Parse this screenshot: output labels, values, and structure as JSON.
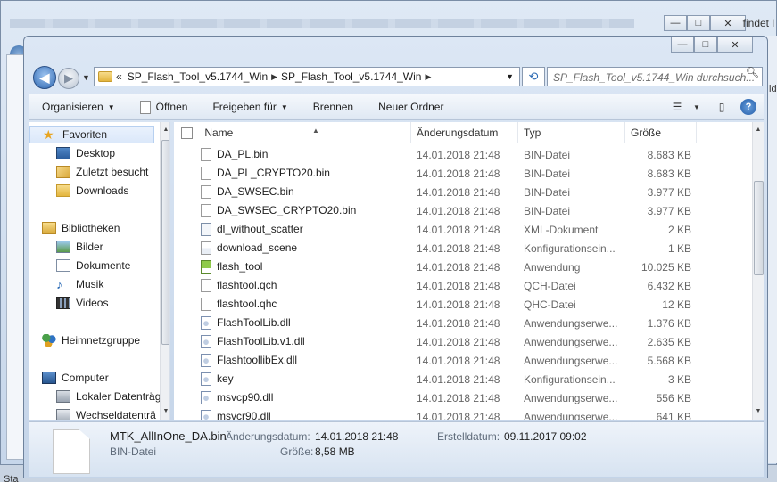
{
  "background_window": {
    "right_edge_text": "findet l",
    "bottom_text": "Sta",
    "right_side_text": "ld"
  },
  "window_controls": {
    "minimize": "—",
    "maximize": "□",
    "close": "✕"
  },
  "address_bar": {
    "breadcrumb_prefix": "«",
    "crumbs": [
      "SP_Flash_Tool_v5.1744_Win",
      "SP_Flash_Tool_v5.1744_Win"
    ],
    "search_placeholder": "SP_Flash_Tool_v5.1744_Win durchsuch..."
  },
  "toolbar": {
    "organize": "Organisieren",
    "open": "Öffnen",
    "share": "Freigeben für",
    "burn": "Brennen",
    "new_folder": "Neuer Ordner"
  },
  "navigation": {
    "favorites": "Favoriten",
    "desktop": "Desktop",
    "recent": "Zuletzt besucht",
    "downloads": "Downloads",
    "libraries": "Bibliotheken",
    "pictures": "Bilder",
    "documents": "Dokumente",
    "music": "Musik",
    "videos": "Videos",
    "homegroup": "Heimnetzgruppe",
    "computer": "Computer",
    "local_disk": "Lokaler Datenträg",
    "removable": "Wechseldatenträ"
  },
  "columns": {
    "name": "Name",
    "date": "Änderungsdatum",
    "type": "Typ",
    "size": "Größe"
  },
  "files": [
    {
      "name": "DA_PL.bin",
      "date": "14.01.2018 21:48",
      "type": "BIN-Datei",
      "size": "8.683 KB",
      "icon": "file-icon"
    },
    {
      "name": "DA_PL_CRYPTO20.bin",
      "date": "14.01.2018 21:48",
      "type": "BIN-Datei",
      "size": "8.683 KB",
      "icon": "file-icon"
    },
    {
      "name": "DA_SWSEC.bin",
      "date": "14.01.2018 21:48",
      "type": "BIN-Datei",
      "size": "3.977 KB",
      "icon": "file-icon"
    },
    {
      "name": "DA_SWSEC_CRYPTO20.bin",
      "date": "14.01.2018 21:48",
      "type": "BIN-Datei",
      "size": "3.977 KB",
      "icon": "file-icon"
    },
    {
      "name": "dl_without_scatter",
      "date": "14.01.2018 21:48",
      "type": "XML-Dokument",
      "size": "2 KB",
      "icon": "xml-icon"
    },
    {
      "name": "download_scene",
      "date": "14.01.2018 21:48",
      "type": "Konfigurationsein...",
      "size": "1 KB",
      "icon": "config-icon"
    },
    {
      "name": "flash_tool",
      "date": "14.01.2018 21:48",
      "type": "Anwendung",
      "size": "10.025 KB",
      "icon": "exe-icon"
    },
    {
      "name": "flashtool.qch",
      "date": "14.01.2018 21:48",
      "type": "QCH-Datei",
      "size": "6.432 KB",
      "icon": "file-icon"
    },
    {
      "name": "flashtool.qhc",
      "date": "14.01.2018 21:48",
      "type": "QHC-Datei",
      "size": "12 KB",
      "icon": "file-icon"
    },
    {
      "name": "FlashToolLib.dll",
      "date": "14.01.2018 21:48",
      "type": "Anwendungserwe...",
      "size": "1.376 KB",
      "icon": "dll-icon"
    },
    {
      "name": "FlashToolLib.v1.dll",
      "date": "14.01.2018 21:48",
      "type": "Anwendungserwe...",
      "size": "2.635 KB",
      "icon": "dll-icon"
    },
    {
      "name": "FlashtoollibEx.dll",
      "date": "14.01.2018 21:48",
      "type": "Anwendungserwe...",
      "size": "5.568 KB",
      "icon": "dll-icon"
    },
    {
      "name": "key",
      "date": "14.01.2018 21:48",
      "type": "Konfigurationsein...",
      "size": "3 KB",
      "icon": "key-icon"
    },
    {
      "name": "msvcp90.dll",
      "date": "14.01.2018 21:48",
      "type": "Anwendungserwe...",
      "size": "556 KB",
      "icon": "dll-icon"
    },
    {
      "name": "msvcr90.dll",
      "date": "14.01.2018 21:48",
      "type": "Anwendungserwe...",
      "size": "641 KB",
      "icon": "dll-icon"
    }
  ],
  "details": {
    "filename": "MTK_AllInOne_DA.bin",
    "modified_label": "Änderungsdatum:",
    "modified_value": "14.01.2018 21:48",
    "created_label": "Erstelldatum:",
    "created_value": "09.11.2017 09:02",
    "type": "BIN-Datei",
    "size_label": "Größe:",
    "size_value": "8,58 MB"
  }
}
